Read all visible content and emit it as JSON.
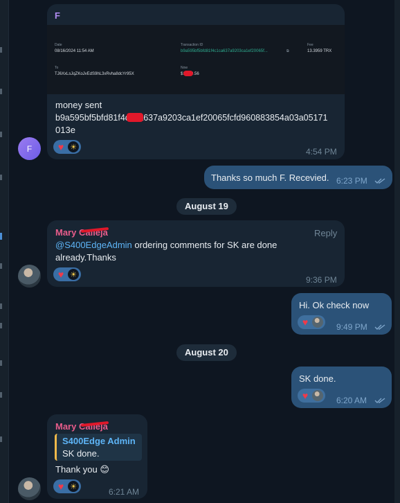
{
  "messages": {
    "m1": {
      "sender_initial": "F",
      "image_header": "F",
      "receipt": {
        "date_label": "Date",
        "date_value": "08/16/2024 11:54 AM",
        "txid_label": "Transaction ID",
        "txid_value": "b9a595bf5bfd81f4c1ca637a9203ca1ef20065f...",
        "fee_label": "Fee",
        "fee_value": "13.3959 TRX",
        "to_label": "To",
        "to_value": "TJ6XxLsJqZKoJvEdS9hL3xRvha8dcYr95X",
        "now_label": "Now",
        "now_value": "$1,000.56"
      },
      "line1": "money sent",
      "line2": "b9a595bf5bfd81f4c1ca637a9203ca1ef20065fcfd960883854a03a05171",
      "line3": "013e",
      "time": "4:54 PM"
    },
    "m2": {
      "text": "Thanks so much F. Recevied.",
      "time": "6:23 PM"
    },
    "date1": "August 19",
    "m3": {
      "sender": "Mary Calleja",
      "reply_label": "Reply",
      "mention": "@S400EdgeAdmin",
      "text_rest": " ordering comments for SK are done",
      "text_line2": "already.Thanks",
      "time": "9:36 PM"
    },
    "m4": {
      "text": "Hi. Ok check now",
      "time": "9:49 PM"
    },
    "date2": "August 20",
    "m5": {
      "text": "SK done.",
      "time": "6:20 AM"
    },
    "m6": {
      "sender": "Mary Calleja",
      "quote_name": "S400Edge Admin",
      "quote_text": "SK done.",
      "text": "Thank you",
      "emoji": "😊",
      "time": "6:21 AM"
    }
  },
  "reactions": {
    "heart": "♥",
    "emoji_sun": "☀"
  },
  "colors": {
    "background": "#0e1621",
    "incoming": "#182533",
    "outgoing": "#2b5278",
    "name": "#e85d8b",
    "link": "#5eb5f7"
  }
}
